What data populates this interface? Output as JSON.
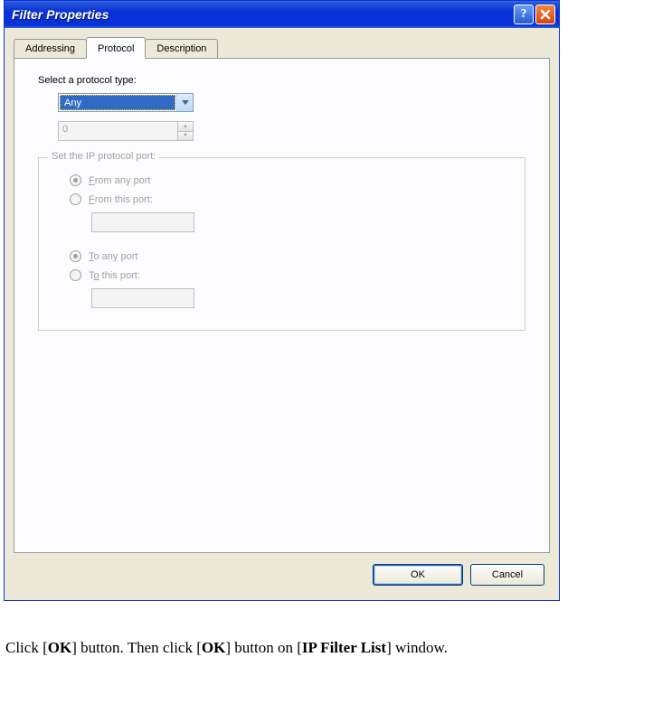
{
  "window": {
    "title": "Filter Properties"
  },
  "tabs": {
    "addressing": "Addressing",
    "protocol": "Protocol",
    "description": "Description"
  },
  "protocol_tab": {
    "select_label": "Select a protocol type:",
    "protocol_value": "Any",
    "spinner_value": "0",
    "group_legend": "Set the IP protocol port:",
    "from_any": "rom any port",
    "from_any_ul": "F",
    "from_this": "rom this port:",
    "from_this_ul": "F",
    "to_any": "o any port",
    "to_any_ul": "T",
    "to_this": " this port:",
    "to_this_ul": "o",
    "to_this_prefix": "T"
  },
  "buttons": {
    "ok": "OK",
    "cancel": "Cancel"
  },
  "instruction": {
    "pre": "Click [",
    "ok": "OK",
    "mid1": "] button. Then click [",
    "ok2": "OK",
    "mid2": "] button on [",
    "ipfl": "IP Filter List",
    "post": "] window."
  }
}
